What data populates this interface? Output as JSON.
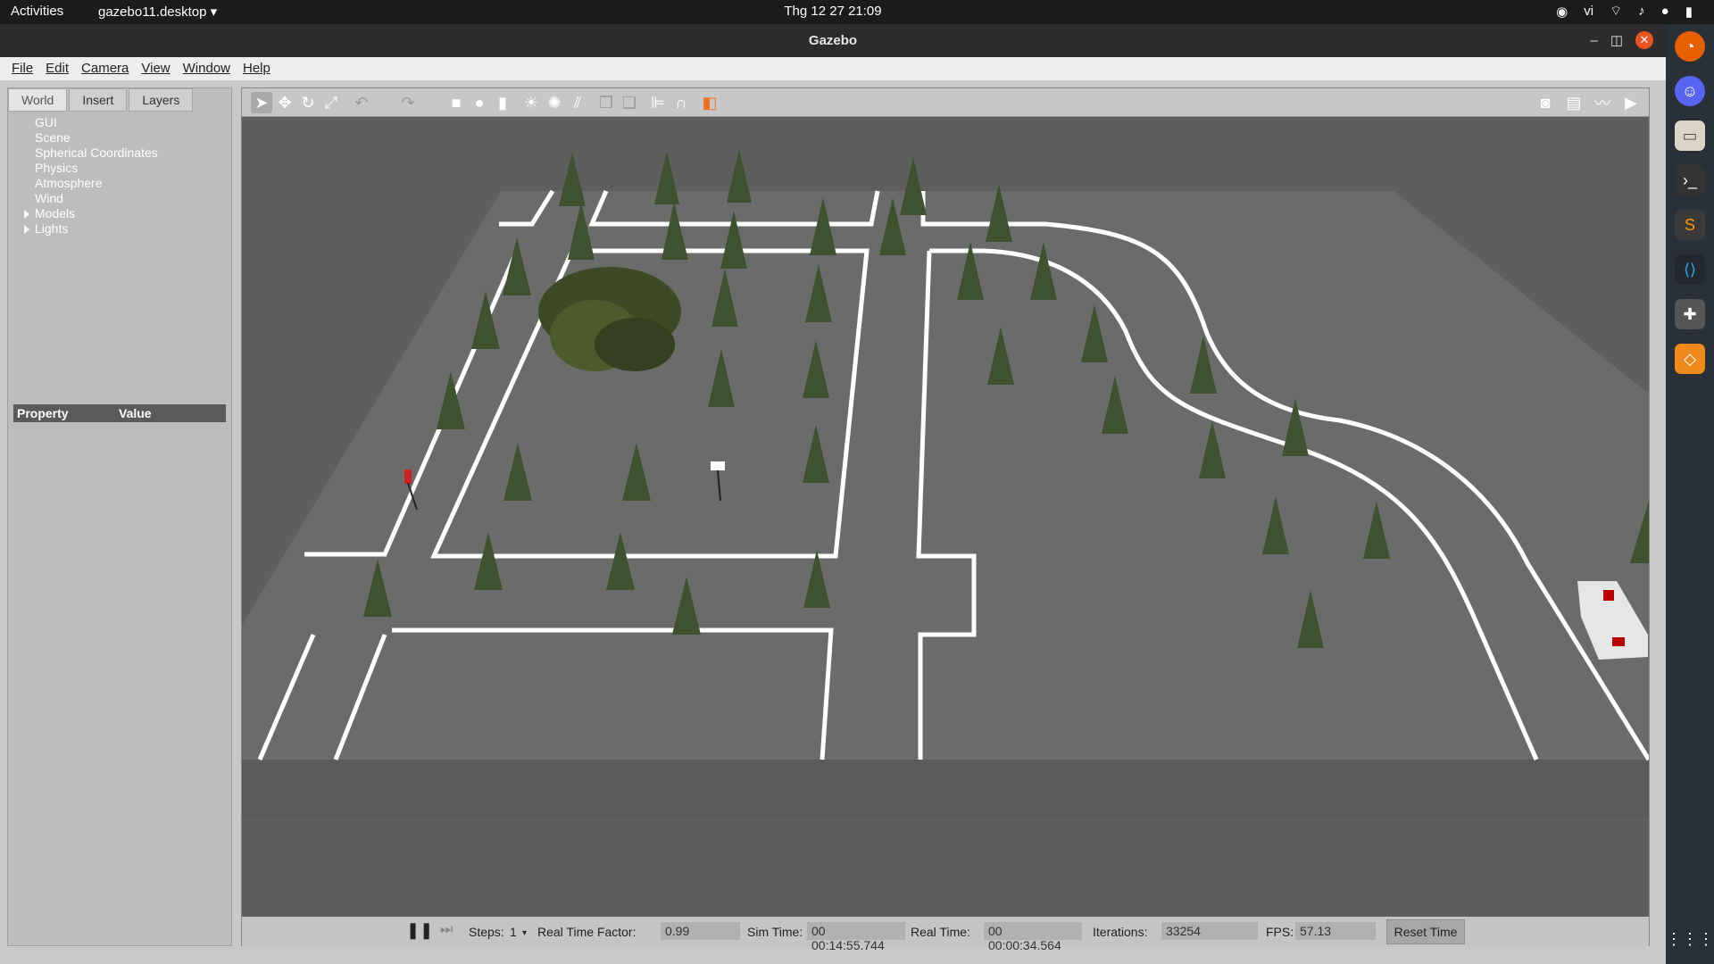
{
  "topbar": {
    "activities": "Activities",
    "app": "gazebo11.desktop",
    "clock": "Thg 12 27  21:09",
    "lang": "vi"
  },
  "window": {
    "title": "Gazebo"
  },
  "menu": [
    "File",
    "Edit",
    "Camera",
    "View",
    "Window",
    "Help"
  ],
  "tabs": [
    "World",
    "Insert",
    "Layers"
  ],
  "tree": {
    "items": [
      "GUI",
      "Scene",
      "Spherical Coordinates",
      "Physics",
      "Atmosphere",
      "Wind"
    ],
    "expandable": [
      "Models",
      "Lights"
    ]
  },
  "props": {
    "property": "Property",
    "value": "Value"
  },
  "status": {
    "steps_label": "Steps:",
    "steps_value": "1",
    "rtf_label": "Real Time Factor:",
    "rtf_value": "0.99",
    "sim_label": "Sim Time:",
    "sim_value": "00 00:14:55.744",
    "real_label": "Real Time:",
    "real_value": "00 00:00:34.564",
    "iter_label": "Iterations:",
    "iter_value": "33254",
    "fps_label": "FPS:",
    "fps_value": "57.13",
    "reset": "Reset Time"
  },
  "colors": {
    "accent": "#e95420",
    "ground": "#6e6e6e",
    "road": "#575757",
    "line": "#ffffff",
    "tree": "#3d4f2a"
  },
  "icons": {
    "toolbar": [
      "select-arrow-icon",
      "translate-icon",
      "rotate-icon",
      "scale-icon",
      "undo-icon",
      "redo-icon",
      "box-icon",
      "sphere-icon",
      "cylinder-icon",
      "point-light-icon",
      "spot-light-icon",
      "directional-light-icon",
      "copy-icon",
      "paste-icon",
      "align-icon",
      "snap-icon",
      "view-angle-icon",
      "screenshot-icon",
      "log-icon",
      "plot-icon",
      "record-icon"
    ]
  }
}
